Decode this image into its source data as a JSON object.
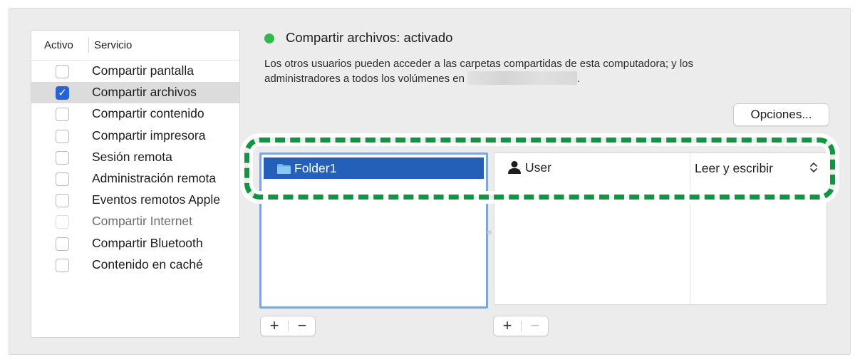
{
  "services": {
    "header": {
      "activo": "Activo",
      "servicio": "Servicio"
    },
    "items": [
      {
        "label": "Compartir pantalla",
        "checked": false,
        "disabled": false
      },
      {
        "label": "Compartir archivos",
        "checked": true,
        "disabled": false,
        "selected": true
      },
      {
        "label": "Compartir contenido",
        "checked": false,
        "disabled": false
      },
      {
        "label": "Compartir impresora",
        "checked": false,
        "disabled": false
      },
      {
        "label": "Sesión remota",
        "checked": false,
        "disabled": false
      },
      {
        "label": "Administración remota",
        "checked": false,
        "disabled": false
      },
      {
        "label": "Eventos remotos Apple",
        "checked": false,
        "disabled": false
      },
      {
        "label": "Compartir Internet",
        "checked": false,
        "disabled": true
      },
      {
        "label": "Compartir Bluetooth",
        "checked": false,
        "disabled": false
      },
      {
        "label": "Contenido en caché",
        "checked": false,
        "disabled": false
      }
    ]
  },
  "status": {
    "text": "Compartir archivos: activado",
    "color": "#30b94d"
  },
  "description": {
    "line1": "Los otros usuarios pueden acceder a las carpetas compartidas de esta computadora; y los",
    "line2_prefix": "administradores a todos los volúmenes en",
    "line2_suffix": "."
  },
  "options_button": "Opciones...",
  "folders": {
    "items": [
      {
        "label": "Folder1",
        "icon": "folder-icon",
        "selected": true
      }
    ]
  },
  "users": {
    "items": [
      {
        "name": "User",
        "icon": "user-icon",
        "permission": "Leer y escribir"
      }
    ]
  },
  "controls": {
    "add": "+",
    "remove": "−"
  },
  "colors": {
    "accent": "#2563d6",
    "selection": "#2460b8",
    "highlight": "#0e9641"
  }
}
